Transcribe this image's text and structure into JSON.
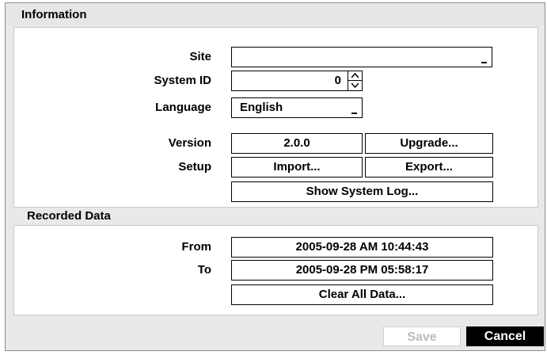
{
  "dialog": {
    "title": "Information"
  },
  "info": {
    "site_label": "Site",
    "site_value": "",
    "system_id_label": "System ID",
    "system_id_value": "0",
    "language_label": "Language",
    "language_value": "English",
    "version_label": "Version",
    "version_value": "2.0.0",
    "upgrade_button": "Upgrade...",
    "setup_label": "Setup",
    "import_button": "Import...",
    "export_button": "Export...",
    "show_log_button": "Show System Log..."
  },
  "recorded": {
    "section_title": "Recorded Data",
    "from_label": "From",
    "from_value": "2005-09-28  AM 10:44:43",
    "to_label": "To",
    "to_value": "2005-09-28  PM 05:58:17",
    "clear_button": "Clear All Data..."
  },
  "footer": {
    "save_label": "Save",
    "cancel_label": "Cancel"
  },
  "colors": {
    "background": "#e9e9e9",
    "cancel_bg": "#000000",
    "disabled_text": "#bdbdbd"
  }
}
